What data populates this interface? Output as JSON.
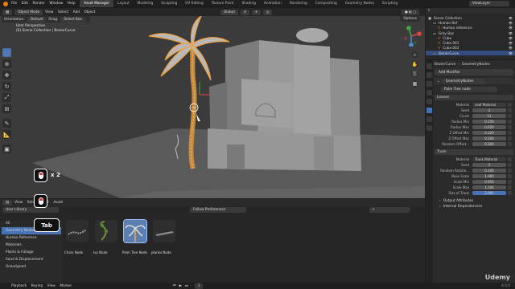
{
  "topbar": {
    "menus": [
      "File",
      "Edit",
      "Render",
      "Window",
      "Help"
    ],
    "workspaces": [
      "Layout",
      "Modeling",
      "Sculpting",
      "UV Editing",
      "Texture Paint",
      "Shading",
      "Animation",
      "Rendering",
      "Compositing",
      "Geometry Nodes",
      "Scripting"
    ],
    "active_workspace": "Asset Manager",
    "view_layer": "ViewLayer"
  },
  "viewport_header": {
    "mode": "Object Mode",
    "menus": [
      "View",
      "Select",
      "Add",
      "Object"
    ],
    "transform_orientation": "Global",
    "options": "Options"
  },
  "tool_header": {
    "orientation_label": "Orientation:",
    "orientation_value": "Default",
    "drag_label": "Drag:",
    "drag_value": "Select Box"
  },
  "viewport": {
    "perspective": "User Perspective",
    "collection_info": "(0) Scene Collection | BezierCurve"
  },
  "overlay_keys": {
    "double_label": "x 2",
    "tab_label": "Tab"
  },
  "asset_browser": {
    "menus": [
      "View",
      "Select",
      "Edit",
      "Asset"
    ],
    "library": "User Library",
    "filter_placeholder": "Follow Preferences",
    "categories": [
      {
        "label": "All",
        "active": false
      },
      {
        "label": "Geometry Nodes",
        "active": true
      },
      {
        "label": "Human Reference",
        "active": false
      },
      {
        "label": "Materials",
        "active": false
      },
      {
        "label": "Plants & Foliage",
        "active": false
      },
      {
        "label": "Sand & Displacement",
        "active": false
      },
      {
        "label": "Unassigned",
        "active": false
      }
    ],
    "assets": [
      {
        "label": "Chain Node",
        "selected": false
      },
      {
        "label": "Ivy Node",
        "selected": false
      },
      {
        "label": "Palm Tree Node",
        "selected": true
      },
      {
        "label": "planks Node",
        "selected": false
      }
    ]
  },
  "statusbar": {
    "left": [
      "Playback",
      "Keying",
      "View",
      "Marker"
    ],
    "hints": [
      "Select",
      "Rotate View",
      "Object"
    ],
    "frame": "1",
    "right": "4.0.0"
  },
  "outliner": {
    "title": "Scene Collection",
    "rows": [
      {
        "label": "Scene Collection",
        "indent": 0
      },
      {
        "label": "Human Ref",
        "indent": 1
      },
      {
        "label": "Human reference",
        "indent": 2
      },
      {
        "label": "Grey Box",
        "indent": 1
      },
      {
        "label": "Cube",
        "indent": 2
      },
      {
        "label": "Cube.001",
        "indent": 2
      },
      {
        "label": "Cube.002",
        "indent": 2
      },
      {
        "label": "BezierCurve",
        "indent": 1
      }
    ]
  },
  "properties": {
    "breadcrumb": [
      "BezierCurve",
      "GeometryNodes"
    ],
    "add_modifier": "Add Modifier",
    "modifier_name": "GeometryNodes",
    "node_group": "Palm Tree node",
    "leaves_panel": "Leaves",
    "leaves_fields": [
      {
        "label": "Material",
        "value": "Leaf Material",
        "type": "material"
      },
      {
        "label": "Seed",
        "value": "2",
        "type": "num"
      },
      {
        "label": "Count",
        "value": "11",
        "type": "num"
      },
      {
        "label": "Radius Min",
        "value": "0.250",
        "type": "num"
      },
      {
        "label": "Radius Max",
        "value": "0.650",
        "type": "num"
      },
      {
        "label": "Z Offset Min",
        "value": "0.320",
        "type": "num"
      },
      {
        "label": "Z Offset Max",
        "value": "0.500",
        "type": "num"
      },
      {
        "label": "Random Offset...",
        "value": "0.200",
        "type": "num"
      }
    ],
    "trunk_panel": "Trunk",
    "trunk_fields": [
      {
        "label": "Material",
        "value": "Trunk Material",
        "type": "material"
      },
      {
        "label": "Seed",
        "value": "2",
        "type": "num"
      },
      {
        "label": "Random Rotatio...",
        "value": "0.100",
        "type": "num"
      },
      {
        "label": "Base Scale",
        "value": "1.000",
        "type": "num"
      },
      {
        "label": "Scale Min",
        "value": "0.850",
        "type": "num"
      },
      {
        "label": "Scale Max",
        "value": "1.500",
        "type": "num"
      },
      {
        "label": "Size of Trunk",
        "value": "2.091",
        "type": "blue"
      }
    ],
    "collapsed": [
      "Output Attributes",
      "Internal Dependencies"
    ]
  },
  "watermark": "Udemy"
}
